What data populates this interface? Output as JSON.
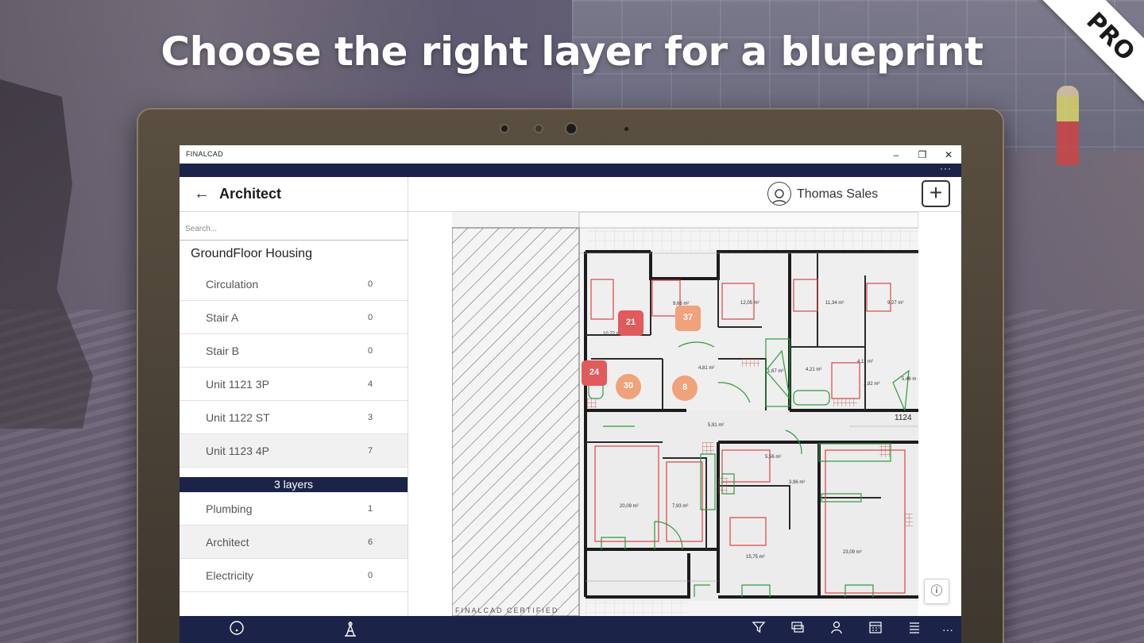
{
  "marketing": {
    "headline": "Choose the right layer for a blueprint",
    "ribbon": "PRO"
  },
  "window": {
    "app_title": "FINALCAD",
    "controls": [
      "minimize-icon",
      "restore-icon",
      "close-icon"
    ],
    "more": "···"
  },
  "header": {
    "back_icon": "arrow-left-icon",
    "title": "Architect",
    "user_name": "Thomas Sales",
    "add_icon": "plus-icon"
  },
  "sidebar": {
    "search_placeholder": "Search...",
    "group_title": "GroundFloor Housing",
    "zones": [
      {
        "label": "Circulation",
        "count": "0"
      },
      {
        "label": "Stair A",
        "count": "0"
      },
      {
        "label": "Stair B",
        "count": "0"
      },
      {
        "label": "Unit 1121 3P",
        "count": "4"
      },
      {
        "label": "Unit 1122 ST",
        "count": "3"
      },
      {
        "label": "Unit 1123 4P",
        "count": "7",
        "selected": true
      }
    ],
    "layers_header": "3 layers",
    "layers": [
      {
        "label": "Plumbing",
        "count": "1"
      },
      {
        "label": "Architect",
        "count": "6",
        "selected": true
      },
      {
        "label": "Electricity",
        "count": "0"
      }
    ]
  },
  "plan": {
    "certified": "FINALCAD CERTIFIED",
    "pins": [
      {
        "label": "21",
        "shape": "square",
        "color": "#e15a5c"
      },
      {
        "label": "37",
        "shape": "square",
        "color": "#f0a27a"
      },
      {
        "label": "24",
        "shape": "square",
        "color": "#e15a5c"
      },
      {
        "label": "30",
        "shape": "round",
        "color": "#f0a27a"
      },
      {
        "label": "8",
        "shape": "round",
        "color": "#f0a27a"
      }
    ],
    "room_areas": [
      "9,66 m²",
      "12,05 m²",
      "10,72 m²",
      "4,81 m²",
      "1,67 m²",
      "5,91 m²",
      "11,34 m²",
      "9,27 m²",
      "4,21 m²",
      "4,11 m²",
      "1,82 m²",
      "5,46 m",
      "5,56 m²",
      "3,96 m²",
      "20,09 m²",
      "7,93 m²",
      "15,75 m²",
      "23,09 m²"
    ],
    "room_number": "1124",
    "info_icon": "info-icon"
  },
  "appbar": {
    "left_icons": [
      "location-pin-icon",
      "blueprint-icon"
    ],
    "right_icons": [
      "filter-icon",
      "layers-icon",
      "user-icon",
      "calendar-icon",
      "list-icon"
    ],
    "more": "···"
  }
}
